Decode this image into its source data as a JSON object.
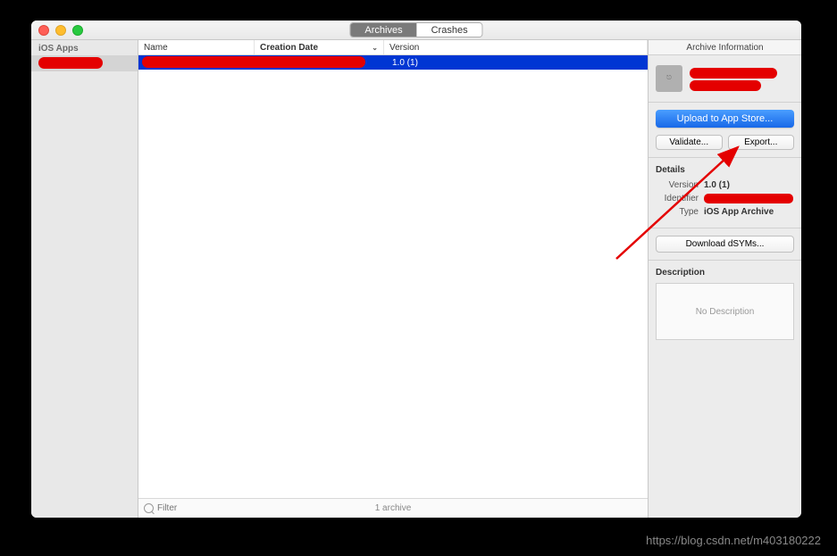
{
  "tabs": {
    "archives": "Archives",
    "crashes": "Crashes"
  },
  "sidebar": {
    "header": "iOS Apps"
  },
  "table": {
    "headers": {
      "name": "Name",
      "date": "Creation Date",
      "version": "Version"
    },
    "rows": [
      {
        "version": "1.0 (1)"
      }
    ]
  },
  "footer": {
    "filter_placeholder": "Filter",
    "count": "1 archive"
  },
  "right": {
    "title": "Archive Information",
    "upload": "Upload to App Store...",
    "validate": "Validate...",
    "export": "Export...",
    "details_title": "Details",
    "version_label": "Version",
    "version_value": "1.0 (1)",
    "identifier_label": "Identifier",
    "type_label": "Type",
    "type_value": "iOS App Archive",
    "download": "Download dSYMs...",
    "description_title": "Description",
    "no_description": "No Description"
  },
  "watermark": "https://blog.csdn.net/m403180222"
}
